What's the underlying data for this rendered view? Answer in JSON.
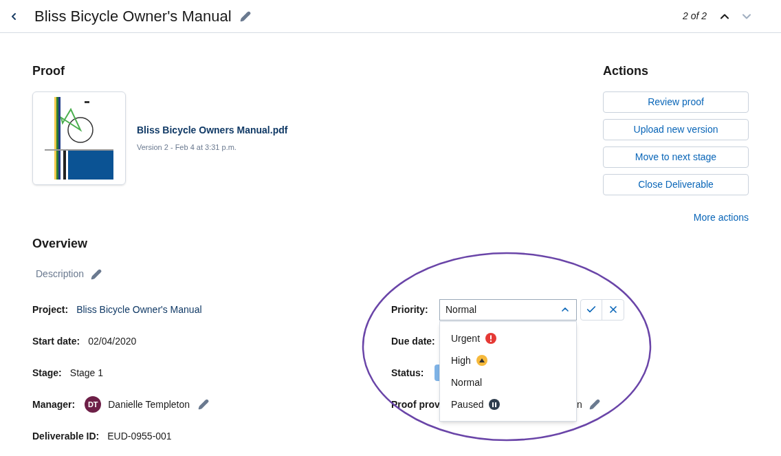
{
  "header": {
    "title": "Bliss Bicycle Owner's Manual",
    "pager": "2 of 2"
  },
  "proof": {
    "heading": "Proof",
    "file_name": "Bliss Bicycle Owners Manual.pdf",
    "version": "Version 2 - Feb 4 at 3:31 p.m."
  },
  "actions": {
    "heading": "Actions",
    "buttons": [
      "Review proof",
      "Upload new version",
      "Move to next stage",
      "Close Deliverable"
    ],
    "more": "More actions"
  },
  "overview": {
    "heading": "Overview",
    "description": "Description",
    "fields": [
      {
        "kind": "link",
        "label": "Project:",
        "value": "Bliss Bicycle Owner's Manual"
      },
      {
        "kind": "text",
        "label": "Start date:",
        "value": "02/04/2020"
      },
      {
        "kind": "text",
        "label": "Stage:",
        "value": "Stage 1"
      },
      {
        "kind": "person",
        "label": "Manager:",
        "initials": "DT",
        "value": "Danielle Templeton"
      },
      {
        "kind": "text",
        "label": "Deliverable ID:",
        "value": "EUD-0955-001"
      }
    ],
    "right_fields": [
      {
        "kind": "select",
        "label": "Priority:",
        "value": "Normal",
        "expanded": true
      },
      {
        "kind": "text",
        "label": "Due date:"
      },
      {
        "kind": "badge",
        "label": "Status:"
      },
      {
        "kind": "edit",
        "label": "Proof prov",
        "value": "n"
      }
    ],
    "priority_options": [
      {
        "label": "Urgent",
        "kind": "urgent"
      },
      {
        "label": "High",
        "kind": "high"
      },
      {
        "label": "Normal",
        "kind": "plain"
      },
      {
        "label": "Paused",
        "kind": "paused"
      }
    ]
  }
}
